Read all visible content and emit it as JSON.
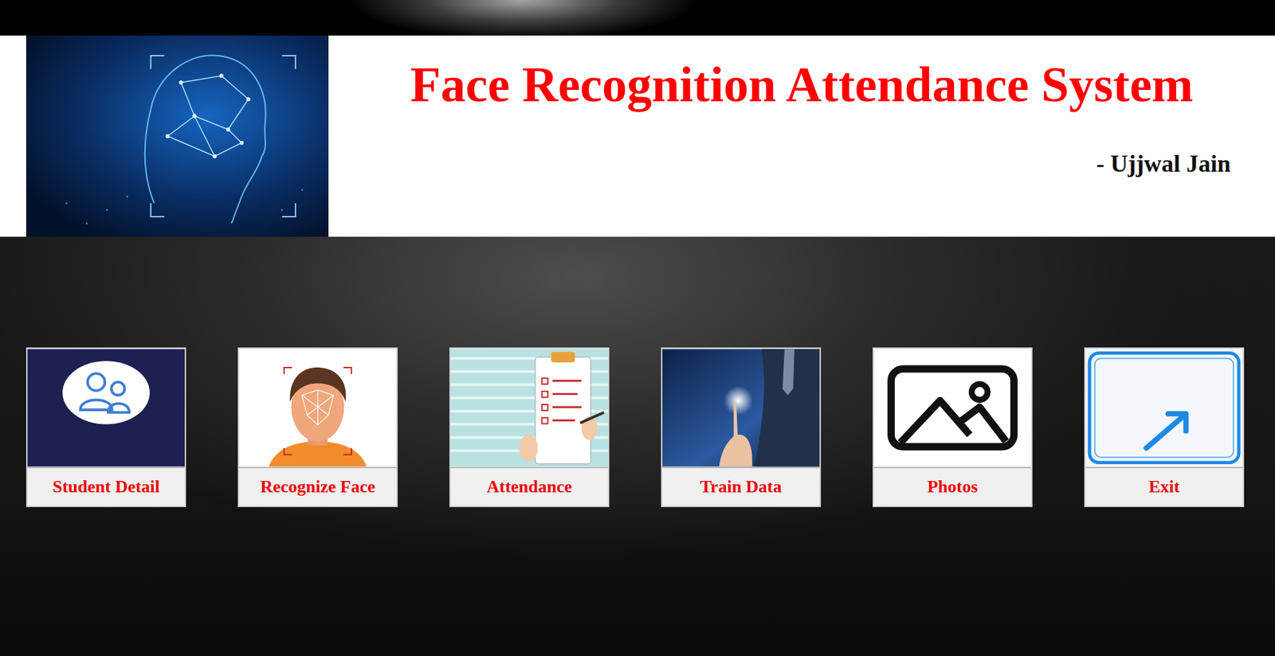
{
  "header": {
    "title": "Face Recognition Attendance System",
    "author": "- Ujjwal Jain"
  },
  "menu": [
    {
      "label": "Student Detail",
      "kind": "student"
    },
    {
      "label": "Recognize Face",
      "kind": "face"
    },
    {
      "label": "Attendance",
      "kind": "attendance"
    },
    {
      "label": "Train Data",
      "kind": "training"
    },
    {
      "label": "Photos",
      "kind": "photos"
    },
    {
      "label": "Exit",
      "kind": "exit"
    }
  ]
}
